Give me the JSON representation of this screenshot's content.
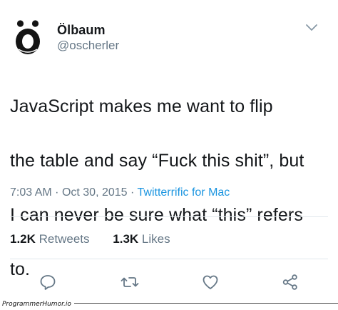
{
  "user": {
    "display_name": "Ölbaum",
    "handle": "@oscherler",
    "avatar_icon": "umlaut-o-face-avatar"
  },
  "tweet": {
    "lines": [
      "JavaScript makes me want to flip",
      "the table and say “Fuck this shit”, but",
      "I can never be sure what “this” refers",
      "to."
    ],
    "time": "7:03 AM",
    "separator": "·",
    "date": "Oct 30, 2015",
    "source": "Twitterrific for Mac"
  },
  "stats": {
    "retweets_count": "1.2K",
    "retweets_label": "Retweets",
    "likes_count": "1.3K",
    "likes_label": "Likes"
  },
  "actions": {
    "icons": [
      "reply-icon",
      "retweet-icon",
      "like-icon",
      "share-icon"
    ]
  },
  "menu_icon": "chevron-down-icon",
  "watermark": "ProgrammerHumor.io",
  "colors": {
    "text": "#14171a",
    "muted": "#657786",
    "link": "#1b95e0",
    "divider": "#e1e8ed"
  }
}
